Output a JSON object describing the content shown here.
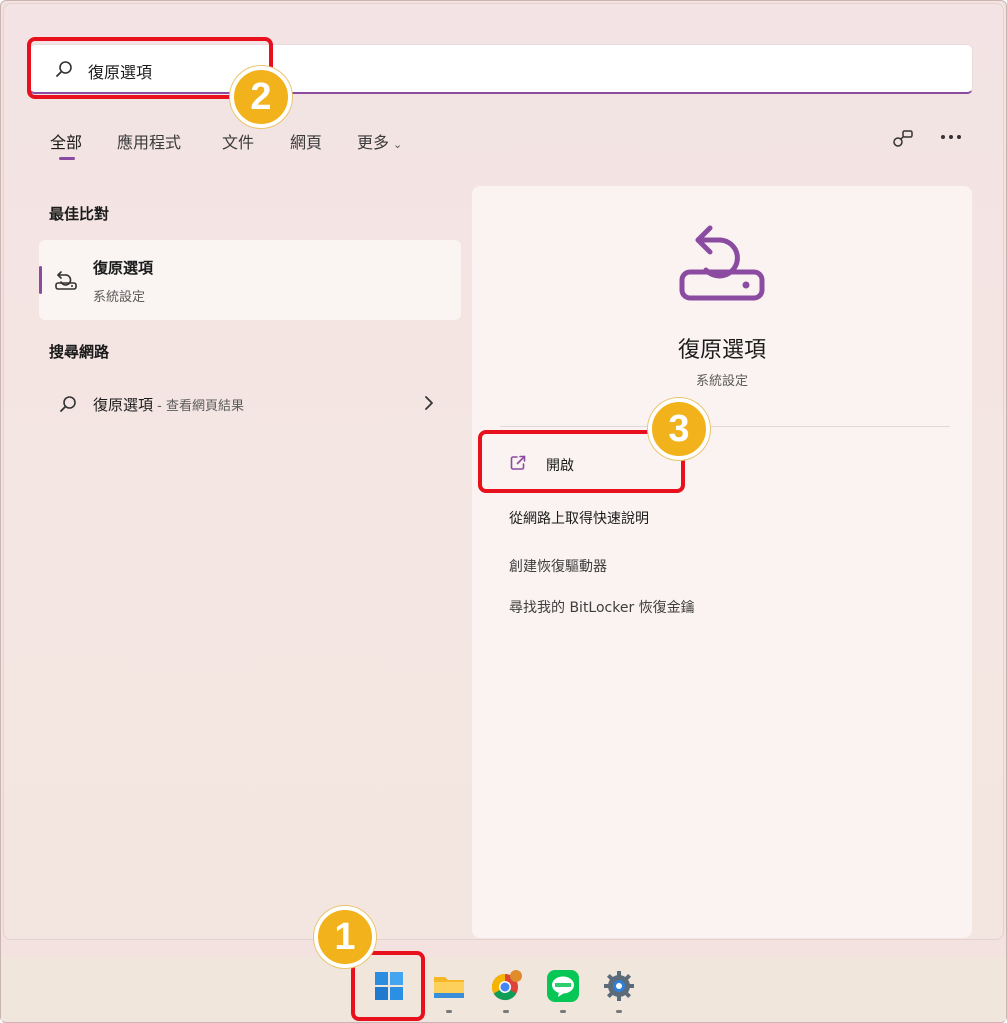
{
  "search": {
    "query": "復原選項"
  },
  "tabs": [
    {
      "label": "全部"
    },
    {
      "label": "應用程式"
    },
    {
      "label": "文件"
    },
    {
      "label": "網頁"
    },
    {
      "label": "更多"
    }
  ],
  "left": {
    "best_match_heading": "最佳比對",
    "best_match": {
      "title": "復原選項",
      "subtitle": "系統設定"
    },
    "web_heading": "搜尋網路",
    "web_result": {
      "query": "復原選項",
      "suffix": " - 查看網頁結果"
    }
  },
  "detail": {
    "title": "復原選項",
    "subtitle": "系統設定",
    "actions": [
      {
        "label": "開啟"
      },
      {
        "label": "從網路上取得快速說明"
      },
      {
        "label": "創建恢復驅動器"
      },
      {
        "label": "尋找我的 BitLocker 恢復金鑰"
      }
    ]
  },
  "callouts": [
    {
      "number": "1"
    },
    {
      "number": "2"
    },
    {
      "number": "3"
    }
  ],
  "colors": {
    "accent": "#8b4ba1",
    "callout_border": "#e8101d",
    "callout_badge": "#f2b21b"
  },
  "icons": [
    "search-icon",
    "recovery-icon",
    "chevron-right-icon",
    "open-external-icon",
    "share-icon",
    "more-icon",
    "windows-start-icon",
    "file-explorer-icon",
    "chrome-icon",
    "line-icon",
    "settings-icon"
  ]
}
